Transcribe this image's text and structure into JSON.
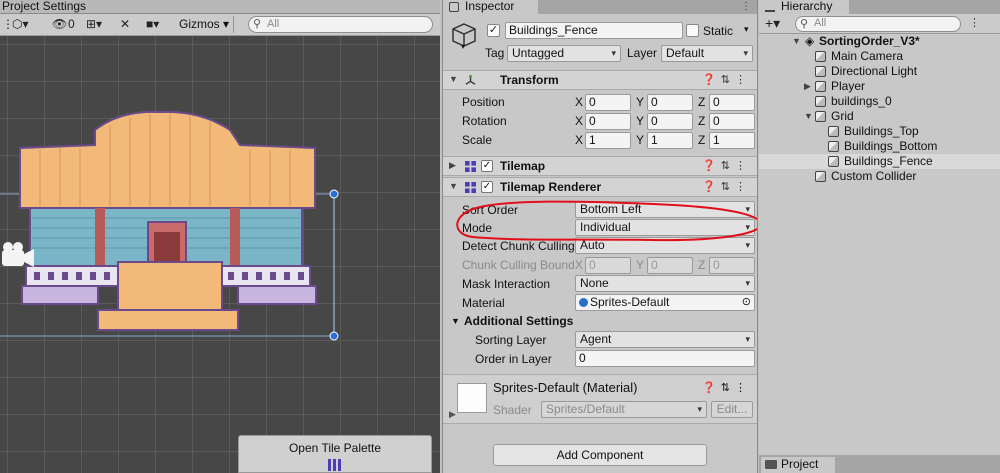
{
  "scene": {
    "tab_title": "Project Settings",
    "toolbar": {
      "visibility_count": "0",
      "gizmos": "Gizmos",
      "search_placeholder": "All"
    },
    "tile_palette_button": "Open Tile Palette"
  },
  "inspector": {
    "tab": "Inspector",
    "object_name": "Buildings_Fence",
    "object_enabled": true,
    "static_label": "Static",
    "static_checked": false,
    "tag_label": "Tag",
    "tag_value": "Untagged",
    "layer_label": "Layer",
    "layer_value": "Default",
    "transform": {
      "title": "Transform",
      "rows": [
        {
          "label": "Position",
          "x": "0",
          "y": "0",
          "z": "0"
        },
        {
          "label": "Rotation",
          "x": "0",
          "y": "0",
          "z": "0"
        },
        {
          "label": "Scale",
          "x": "1",
          "y": "1",
          "z": "1"
        }
      ],
      "axis_x": "X",
      "axis_y": "Y",
      "axis_z": "Z"
    },
    "tilemap": {
      "title": "Tilemap",
      "enabled": true
    },
    "tilemap_renderer": {
      "title": "Tilemap Renderer",
      "enabled": true,
      "sort_order_label": "Sort Order",
      "sort_order_value": "Bottom Left",
      "mode_label": "Mode",
      "mode_value": "Individual",
      "detect_chunk_label": "Detect Chunk Culling",
      "detect_chunk_value": "Auto",
      "chunk_bounds_label": "Chunk Culling Bounds",
      "chunk_bounds": {
        "x": "0",
        "y": "0",
        "z": "0"
      },
      "mask_label": "Mask Interaction",
      "mask_value": "None",
      "material_label": "Material",
      "material_value": "Sprites-Default",
      "additional_title": "Additional Settings",
      "sorting_layer_label": "Sorting Layer",
      "sorting_layer_value": "Agent",
      "order_label": "Order in Layer",
      "order_value": "0"
    },
    "material_section": {
      "title": "Sprites-Default (Material)",
      "shader_label": "Shader",
      "shader_value": "Sprites/Default",
      "edit_label": "Edit..."
    },
    "add_component": "Add Component"
  },
  "hierarchy": {
    "tab": "Hierarchy",
    "search_placeholder": "All",
    "scene_name": "SortingOrder_V3*",
    "items": [
      {
        "label": "Main Camera",
        "depth": 1,
        "foldable": false,
        "selected": false
      },
      {
        "label": "Directional Light",
        "depth": 1,
        "foldable": false,
        "selected": false
      },
      {
        "label": "Player",
        "depth": 1,
        "foldable": true,
        "expanded": false,
        "selected": false
      },
      {
        "label": "buildings_0",
        "depth": 1,
        "foldable": false,
        "selected": false
      },
      {
        "label": "Grid",
        "depth": 1,
        "foldable": true,
        "expanded": true,
        "selected": false
      },
      {
        "label": "Buildings_Top",
        "depth": 2,
        "foldable": false,
        "selected": false
      },
      {
        "label": "Buildings_Bottom",
        "depth": 2,
        "foldable": false,
        "selected": false
      },
      {
        "label": "Buildings_Fence",
        "depth": 2,
        "foldable": false,
        "selected": true
      },
      {
        "label": "Custom Collider",
        "depth": 1,
        "foldable": false,
        "selected": false
      }
    ],
    "project_tab": "Project"
  },
  "colors": {
    "annotation_red": "#e0101a",
    "handle_blue": "#2b6fd8",
    "roof": "#f2b978",
    "wall": "#7bb6c8",
    "trim": "#b85a5a",
    "outline": "#6a4a8a"
  }
}
